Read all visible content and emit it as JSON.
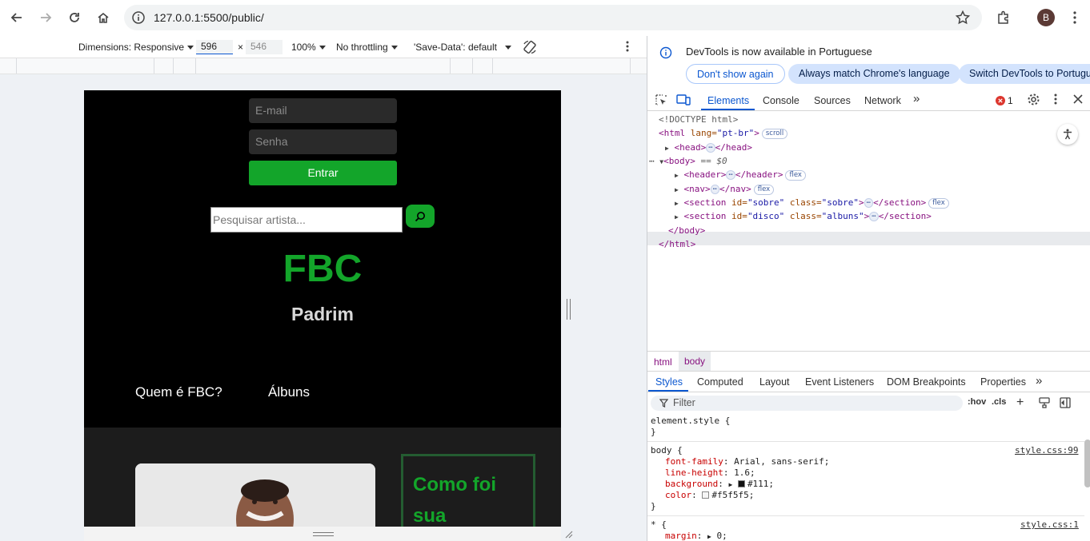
{
  "browser": {
    "url": "127.0.0.1:5500/public/",
    "profile_initial": "B"
  },
  "device_toolbar": {
    "dimensions_label": "Dimensions: Responsive",
    "width": "596",
    "height": "546",
    "times": "×",
    "zoom": "100%",
    "throttling": "No throttling",
    "save_data": "'Save-Data': default"
  },
  "site": {
    "email_placeholder": "E-mail",
    "password_placeholder": "Senha",
    "login_button": "Entrar",
    "search_placeholder": "Pesquisar artista...",
    "brand": "FBC",
    "subbrand": "Padrim",
    "nav": [
      "Quem é FBC?",
      "Álbuns"
    ],
    "about_title": "Como foi sua"
  },
  "devtools": {
    "notice": "DevTools is now available in Portuguese",
    "buttons": {
      "dont_show": "Don't show again",
      "match_language": "Always match Chrome's language",
      "switch": "Switch DevTools to Portuguese"
    },
    "tabs": [
      "Elements",
      "Console",
      "Sources",
      "Network"
    ],
    "error_count": "1",
    "dom": {
      "doctype": "<!DOCTYPE html>",
      "html_open": "<html",
      "html_attr": " lang=",
      "html_lang": "\"pt-br\"",
      "scroll_badge": "scroll",
      "head": "<head>",
      "head_close": "</head>",
      "body": "<body>",
      "body_eq": " == $0",
      "header": "<header>",
      "header_close": "</header>",
      "nav": "<nav>",
      "nav_close": "</nav>",
      "section": "<section",
      "section_close": "</section>",
      "id_attr": " id=",
      "class_attr": " class=",
      "sobre_id": "\"sobre\"",
      "sobre_class": "\"sobre\"",
      "disco_id": "\"disco\"",
      "albuns_class": "\"albuns\"",
      "gt": ">",
      "flex_badge": "flex",
      "body_close": "</body>",
      "html_close": "</html>",
      "ellipsis": "⋯"
    },
    "breadcrumbs": [
      "html",
      "body"
    ],
    "style_tabs": [
      "Styles",
      "Computed",
      "Layout",
      "Event Listeners",
      "DOM Breakpoints",
      "Properties"
    ],
    "filter_placeholder": "Filter",
    "hov": ":hov",
    "cls": ".cls",
    "rules": {
      "element_style": "element.style {",
      "close_brace": "}",
      "body_selector": "body {",
      "body_source": "style.css:99",
      "font_family_prop": "font-family",
      "font_family_val": "Arial, sans-serif;",
      "line_height_prop": "line-height",
      "line_height_val": "1.6;",
      "background_prop": "background",
      "background_val": "#111;",
      "color_prop": "color",
      "color_val": "#f5f5f5;",
      "star_selector": "* {",
      "star_source": "style.css:1",
      "margin_prop": "margin",
      "margin_val": "0;"
    }
  },
  "colors": {
    "accent_green": "#13a52a",
    "devtools_blue": "#0b57d0"
  }
}
